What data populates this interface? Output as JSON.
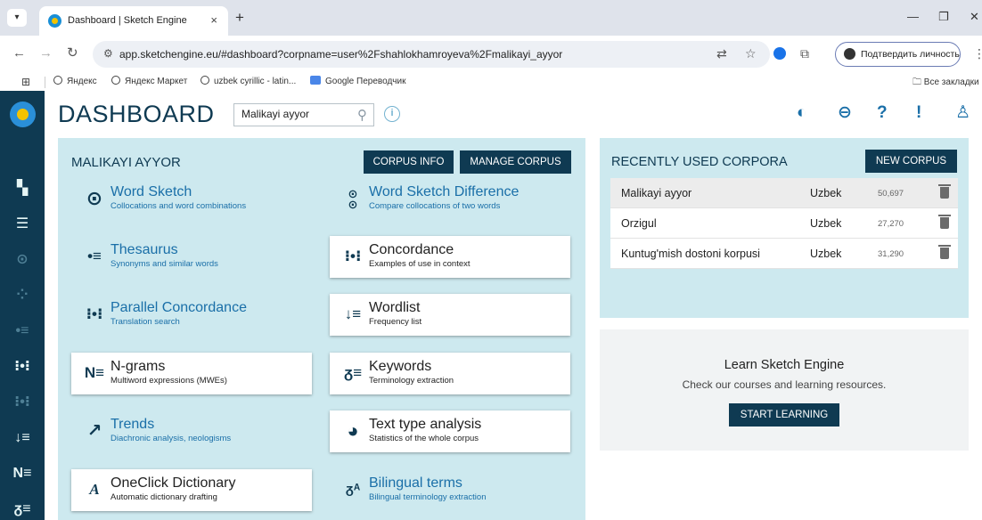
{
  "browser": {
    "tab_title": "Dashboard | Sketch Engine",
    "tab_close": "×",
    "new_tab": "+",
    "url": "app.sketchengine.eu/#dashboard?corpname=user%2Fshahlokhamroyeva%2Fmalikayi_ayyor",
    "profile_button": "Подтвердить личность",
    "bookmarks": [
      "Яндекс",
      "Яндекс Маркет",
      "uzbek cyrillic - latin...",
      "Google Переводчик"
    ],
    "all_bookmarks": "Все закладки"
  },
  "topbar": {
    "title": "DASHBOARD",
    "corpus_search_value": "Malikayi ayyor",
    "info_label": "i"
  },
  "main": {
    "corpus_title": "MALIKAYI AYYOR",
    "corpus_info_btn": "CORPUS INFO",
    "manage_corpus_btn": "MANAGE CORPUS",
    "features": [
      {
        "title": "Word Sketch",
        "subtitle": "Collocations and word combinations",
        "icon": "word-sketch-icon"
      },
      {
        "title": "Word Sketch Difference",
        "subtitle": "Compare collocations of two words",
        "icon": "word-sketch-difference-icon"
      },
      {
        "title": "Thesaurus",
        "subtitle": "Synonyms and similar words",
        "icon": "thesaurus-icon"
      },
      {
        "title": "Concordance",
        "subtitle": "Examples of use in context",
        "icon": "concordance-icon"
      },
      {
        "title": "Parallel Concordance",
        "subtitle": "Translation search",
        "icon": "parallel-concordance-icon"
      },
      {
        "title": "Wordlist",
        "subtitle": "Frequency list",
        "icon": "wordlist-icon"
      },
      {
        "title": "N-grams",
        "subtitle": "Multiword expressions (MWEs)",
        "icon": "ngrams-icon"
      },
      {
        "title": "Keywords",
        "subtitle": "Terminology extraction",
        "icon": "keywords-icon"
      },
      {
        "title": "Trends",
        "subtitle": "Diachronic analysis, neologisms",
        "icon": "trends-icon"
      },
      {
        "title": "Text type analysis",
        "subtitle": "Statistics of the whole corpus",
        "icon": "text-type-analysis-icon"
      },
      {
        "title": "OneClick Dictionary",
        "subtitle": "Automatic dictionary drafting",
        "icon": "oneclick-dictionary-icon"
      },
      {
        "title": "Bilingual terms",
        "subtitle": "Bilingual terminology extraction",
        "icon": "bilingual-terms-icon"
      }
    ]
  },
  "recent": {
    "title": "RECENTLY USED CORPORA",
    "new_corpus_btn": "NEW CORPUS",
    "rows": [
      {
        "name": "Malikayi ayyor",
        "language": "Uzbek",
        "size": "50,697"
      },
      {
        "name": "Orzigul",
        "language": "Uzbek",
        "size": "27,270"
      },
      {
        "name": "Kuntug'mish dostoni korpusi",
        "language": "Uzbek",
        "size": "31,290"
      }
    ]
  },
  "learn": {
    "title": "Learn Sketch Engine",
    "subtitle": "Check our courses and learning resources.",
    "button": "START LEARNING"
  },
  "colors": {
    "sidebar": "#0f3a52",
    "panel": "#cde9ef",
    "dark_button": "#0f3a52",
    "link": "#1a6fa8"
  }
}
